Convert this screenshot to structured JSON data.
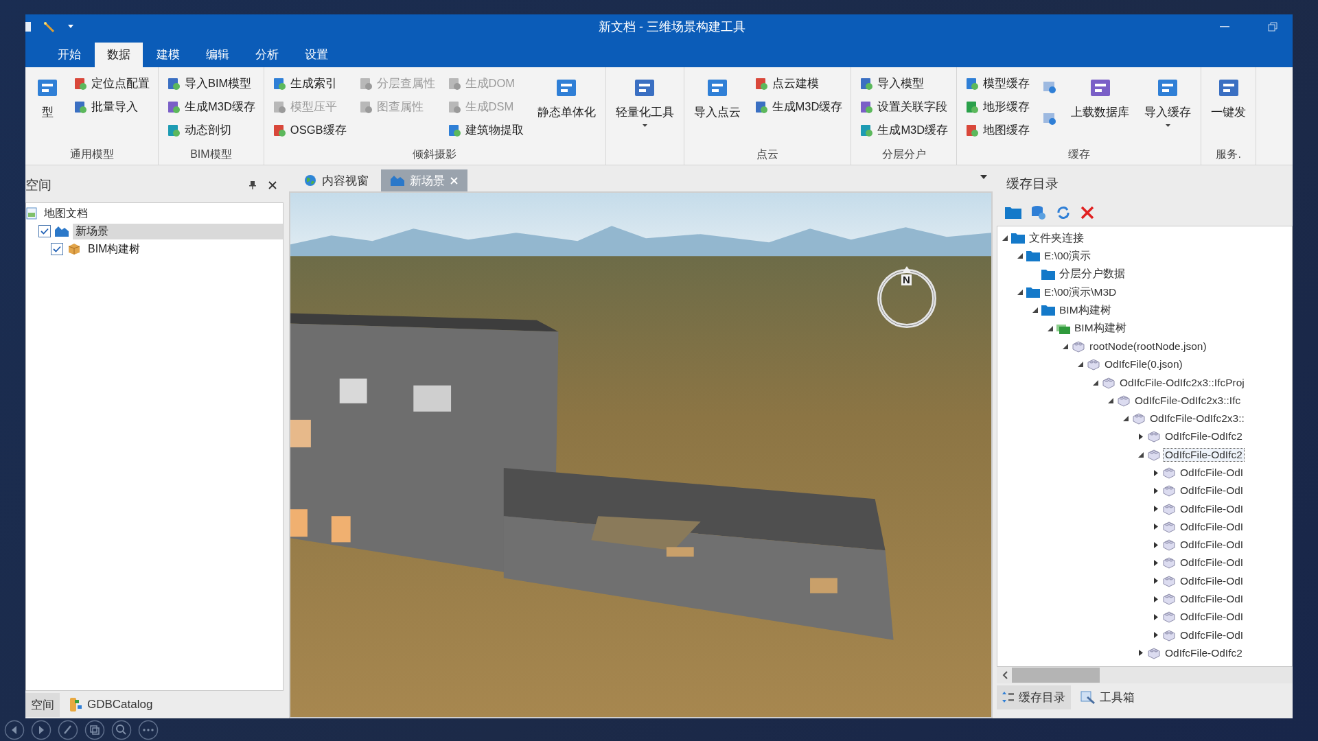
{
  "window": {
    "title": "新文档 - 三维场景构建工具"
  },
  "ribbon_tabs": [
    {
      "label": "开始",
      "selected": false
    },
    {
      "label": "数据",
      "selected": true
    },
    {
      "label": "建模",
      "selected": false
    },
    {
      "label": "编辑",
      "selected": false
    },
    {
      "label": "分析",
      "selected": false
    },
    {
      "label": "设置",
      "selected": false
    }
  ],
  "ribbon_groups": [
    {
      "label": "通用模型",
      "columns": [
        {
          "kind": "large",
          "label": "型",
          "dropdown": false
        },
        {
          "kind": "stack",
          "items": [
            {
              "label": "定位点配置",
              "disabled": false
            },
            {
              "label": "批量导入",
              "disabled": false
            }
          ]
        }
      ]
    },
    {
      "label": "BIM模型",
      "columns": [
        {
          "kind": "stack",
          "items": [
            {
              "label": "导入BIM模型",
              "disabled": false
            },
            {
              "label": "生成M3D缓存",
              "disabled": false
            },
            {
              "label": "动态剖切",
              "disabled": false
            }
          ]
        }
      ]
    },
    {
      "label": "倾斜摄影",
      "columns": [
        {
          "kind": "stack",
          "items": [
            {
              "label": "生成索引",
              "disabled": false
            },
            {
              "label": "模型压平",
              "disabled": true
            },
            {
              "label": "OSGB缓存",
              "disabled": false
            }
          ]
        },
        {
          "kind": "stack",
          "items": [
            {
              "label": "分层查属性",
              "disabled": true
            },
            {
              "label": "图查属性",
              "disabled": true
            }
          ]
        },
        {
          "kind": "stack",
          "items": [
            {
              "label": "生成DOM",
              "disabled": true
            },
            {
              "label": "生成DSM",
              "disabled": true
            },
            {
              "label": "建筑物提取",
              "disabled": false
            }
          ]
        },
        {
          "kind": "large",
          "label": "静态单体化",
          "dropdown": false
        }
      ]
    },
    {
      "columns": [
        {
          "kind": "large",
          "label": "轻量化工具",
          "dropdown": true
        }
      ]
    },
    {
      "label": "点云",
      "columns": [
        {
          "kind": "large",
          "label": "导入点云",
          "dropdown": false
        },
        {
          "kind": "stack",
          "items": [
            {
              "label": "点云建模",
              "disabled": false
            },
            {
              "label": "生成M3D缓存",
              "disabled": false
            }
          ]
        }
      ]
    },
    {
      "label": "分层分户",
      "columns": [
        {
          "kind": "stack",
          "items": [
            {
              "label": "导入模型",
              "disabled": false
            },
            {
              "label": "设置关联字段",
              "disabled": false
            },
            {
              "label": "生成M3D缓存",
              "disabled": false
            }
          ]
        }
      ]
    },
    {
      "label": "缓存",
      "columns": [
        {
          "kind": "stack",
          "items": [
            {
              "label": "模型缓存",
              "disabled": false
            },
            {
              "label": "地形缓存",
              "disabled": false
            },
            {
              "label": "地图缓存",
              "disabled": false
            }
          ]
        },
        {
          "kind": "icon_stack",
          "items": [
            {
              "disabled": false
            },
            {
              "disabled": false
            }
          ]
        },
        {
          "kind": "large",
          "label": "上载数据库",
          "dropdown": false
        },
        {
          "kind": "large",
          "label": "导入缓存",
          "dropdown": true
        }
      ]
    },
    {
      "label": "服务.",
      "columns": [
        {
          "kind": "large",
          "label": "一键发",
          "dropdown": false
        }
      ]
    }
  ],
  "workspace": {
    "title": "空间",
    "tree": [
      {
        "kind": "document",
        "label": "地图文档",
        "selected": false,
        "children": [
          {
            "kind": "scene",
            "label": "新场景",
            "checked": true,
            "selected": true,
            "children": [
              {
                "kind": "model",
                "label": "BIM构建树",
                "checked": true,
                "selected": false
              }
            ]
          }
        ]
      }
    ],
    "tabs": [
      {
        "label": "空间",
        "selected": true
      },
      {
        "label": "GDBCatalog",
        "selected": false
      }
    ]
  },
  "document_tabs": [
    {
      "kind": "globe",
      "label": "内容视窗",
      "selected": false,
      "closable": false
    },
    {
      "kind": "scene",
      "label": "新场景",
      "selected": true,
      "closable": true
    }
  ],
  "viewport": {
    "kind": "picture",
    "compass_label": "N"
  },
  "cache_panel": {
    "title": "缓存目录",
    "tree": [
      {
        "kind": "folder",
        "label": "文件夹连接",
        "expanded": true,
        "selected": false,
        "children": [
          {
            "kind": "folder",
            "label": "E:\\00演示",
            "expanded": true,
            "selected": false,
            "children": [
              {
                "kind": "folder",
                "label": "分层分户数据",
                "selected": false
              }
            ]
          },
          {
            "kind": "folder",
            "label": "E:\\00演示\\M3D",
            "expanded": true,
            "selected": false,
            "children": [
              {
                "kind": "folder",
                "label": "BIM构建树",
                "expanded": true,
                "selected": false,
                "children": [
                  {
                    "kind": "layer",
                    "label": "BIM构建树",
                    "expanded": true,
                    "selected": false,
                    "children": [
                      {
                        "kind": "block",
                        "label": "rootNode(rootNode.json)",
                        "expanded": true,
                        "selected": false,
                        "children": [
                          {
                            "kind": "block",
                            "label": "OdIfcFile(0.json)",
                            "expanded": true,
                            "selected": false,
                            "children": [
                              {
                                "kind": "block",
                                "label": "OdIfcFile-OdIfc2x3::IfcProj",
                                "expanded": true,
                                "selected": false,
                                "children": [
                                  {
                                    "kind": "block",
                                    "label": "OdIfcFile-OdIfc2x3::Ifc",
                                    "expanded": true,
                                    "selected": false,
                                    "children": [
                                      {
                                        "kind": "block",
                                        "label": "OdIfcFile-OdIfc2x3::",
                                        "expanded": true,
                                        "selected": false,
                                        "children": [
                                          {
                                            "kind": "block",
                                            "label": "OdIfcFile-OdIfc2",
                                            "expanded": false,
                                            "selected": false
                                          },
                                          {
                                            "kind": "block",
                                            "label": "OdIfcFile-OdIfc2",
                                            "expanded": true,
                                            "selected": true,
                                            "children": [
                                              {
                                                "kind": "block",
                                                "label": "OdIfcFile-OdI",
                                                "expanded": false,
                                                "selected": false
                                              },
                                              {
                                                "kind": "block",
                                                "label": "OdIfcFile-OdI",
                                                "expanded": false,
                                                "selected": false
                                              },
                                              {
                                                "kind": "block",
                                                "label": "OdIfcFile-OdI",
                                                "expanded": false,
                                                "selected": false
                                              },
                                              {
                                                "kind": "block",
                                                "label": "OdIfcFile-OdI",
                                                "expanded": false,
                                                "selected": false
                                              },
                                              {
                                                "kind": "block",
                                                "label": "OdIfcFile-OdI",
                                                "expanded": false,
                                                "selected": false
                                              },
                                              {
                                                "kind": "block",
                                                "label": "OdIfcFile-OdI",
                                                "expanded": false,
                                                "selected": false
                                              },
                                              {
                                                "kind": "block",
                                                "label": "OdIfcFile-OdI",
                                                "expanded": false,
                                                "selected": false
                                              },
                                              {
                                                "kind": "block",
                                                "label": "OdIfcFile-OdI",
                                                "expanded": false,
                                                "selected": false
                                              },
                                              {
                                                "kind": "block",
                                                "label": "OdIfcFile-OdI",
                                                "expanded": false,
                                                "selected": false
                                              },
                                              {
                                                "kind": "block",
                                                "label": "OdIfcFile-OdI",
                                                "expanded": false,
                                                "selected": false
                                              }
                                            ]
                                          },
                                          {
                                            "kind": "block",
                                            "label": "OdIfcFile-OdIfc2",
                                            "expanded": false,
                                            "selected": false
                                          }
                                        ]
                                      }
                                    ]
                                  }
                                ]
                              }
                            ]
                          }
                        ]
                      }
                    ]
                  }
                ]
              }
            ]
          }
        ]
      }
    ],
    "tabs": [
      {
        "label": "缓存目录",
        "selected": true
      },
      {
        "label": "工具箱",
        "selected": false
      }
    ]
  }
}
